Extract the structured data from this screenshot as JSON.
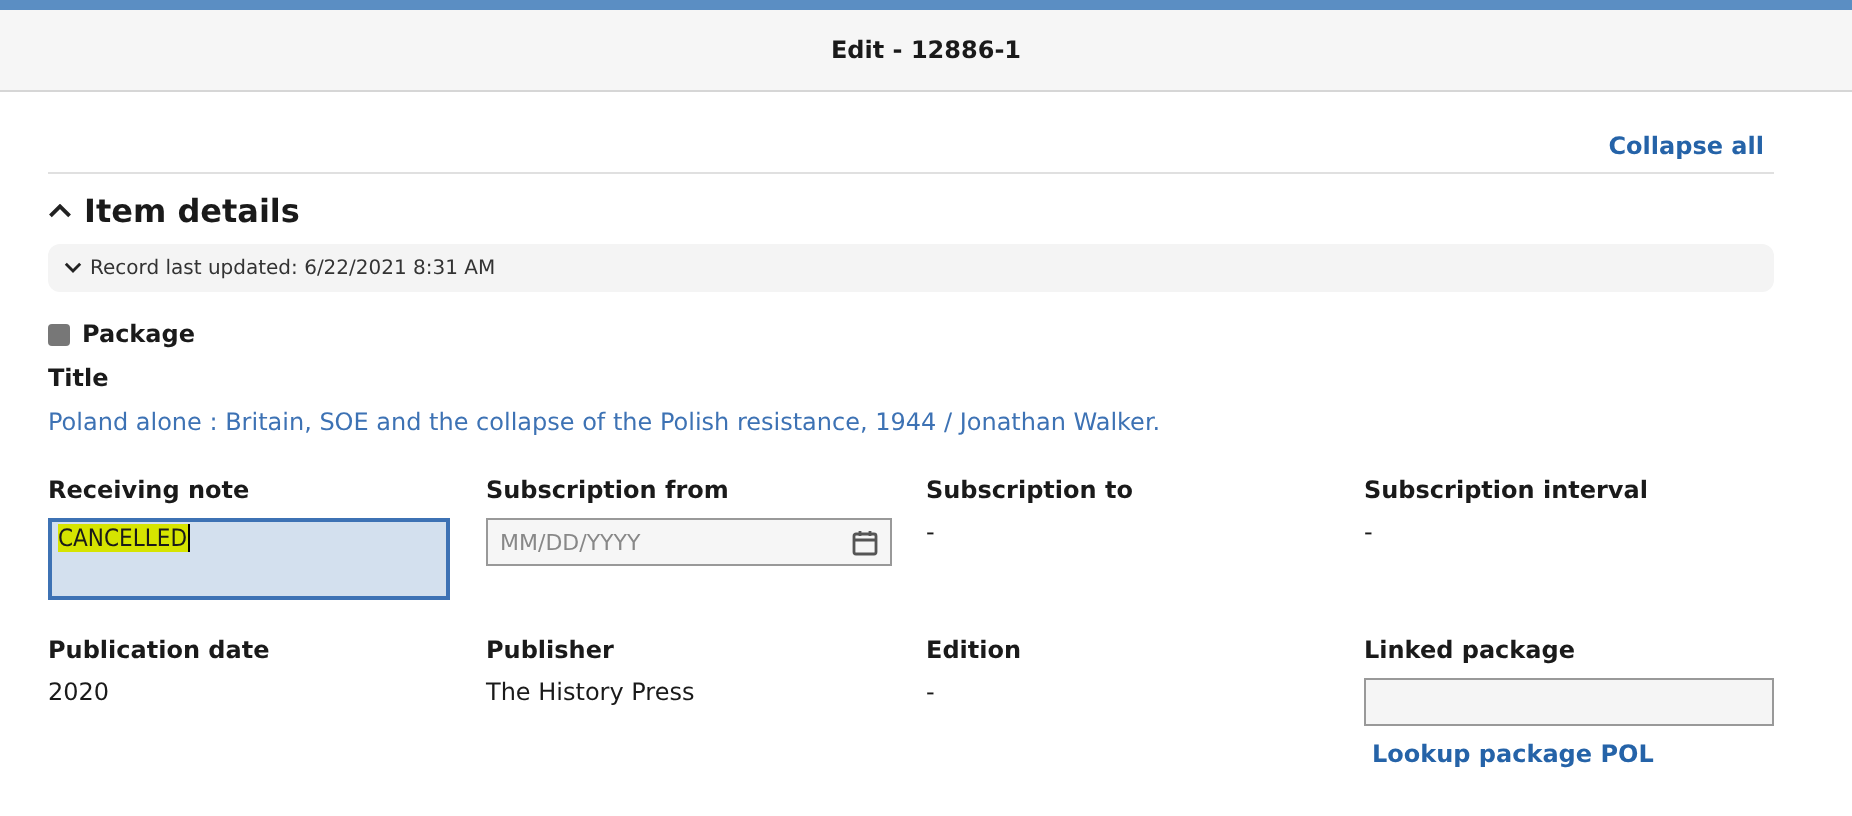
{
  "header": {
    "title": "Edit - 12886-1"
  },
  "collapse_all": "Collapse all",
  "section": {
    "title": "Item details",
    "expanded": true,
    "record": {
      "text": "Record last updated: 6/22/2021 8:31 AM",
      "expanded": false
    }
  },
  "package": {
    "label": "Package",
    "checked": false
  },
  "title": {
    "label": "Title",
    "value": "Poland alone : Britain, SOE and the collapse of the Polish resistance, 1944 / Jonathan Walker."
  },
  "fields": [
    {
      "kind": "textarea",
      "label": "Receiving note",
      "value": "CANCELLED",
      "text_selected": true
    },
    {
      "kind": "date",
      "label": "Subscription from",
      "placeholder": "MM/DD/YYYY"
    },
    {
      "kind": "text",
      "label": "Subscription to",
      "value": "-"
    },
    {
      "kind": "text",
      "label": "Subscription interval",
      "value": "-"
    },
    {
      "kind": "text",
      "label": "Publication date",
      "value": "2020"
    },
    {
      "kind": "text",
      "label": "Publisher",
      "value": "The History Press"
    },
    {
      "kind": "text",
      "label": "Edition",
      "value": "-"
    },
    {
      "kind": "lookup",
      "label": "Linked package",
      "link": "Lookup package POL"
    }
  ]
}
